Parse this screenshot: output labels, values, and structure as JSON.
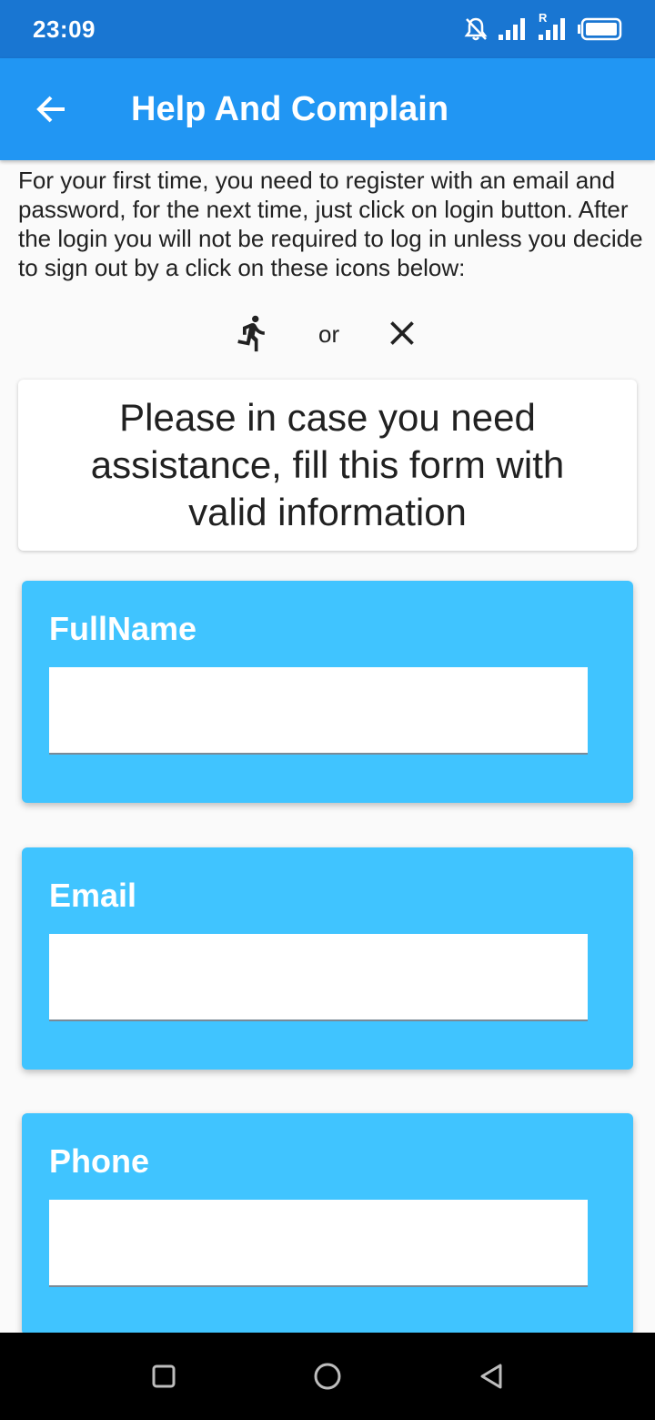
{
  "status_bar": {
    "time": "23:09",
    "icons": [
      "bell-off-icon",
      "signal-icon",
      "signal-roaming-icon",
      "battery-icon"
    ],
    "roaming_label": "R",
    "color": "#1976d2"
  },
  "app_bar": {
    "title": "Help And Complain",
    "back_icon": "arrow-left-icon",
    "color": "#2196f3"
  },
  "intro": {
    "text": "For your first time, you need to register with an email and password, for the next time, just click on login button. After the login you will not be required to log in unless you decide to sign out by a click on these icons below:",
    "icons": [
      "run-icon",
      "close-icon"
    ],
    "or_label": "or"
  },
  "notice": {
    "text": "Please in case you need assistance, fill this form with valid information"
  },
  "form": {
    "card_color": "#40c4ff",
    "fields": [
      {
        "label": "FullName",
        "value": ""
      },
      {
        "label": "Email",
        "value": ""
      },
      {
        "label": "Phone",
        "value": ""
      }
    ]
  },
  "nav_bar": {
    "buttons": [
      "recents-square-icon",
      "home-circle-icon",
      "back-triangle-icon"
    ]
  }
}
